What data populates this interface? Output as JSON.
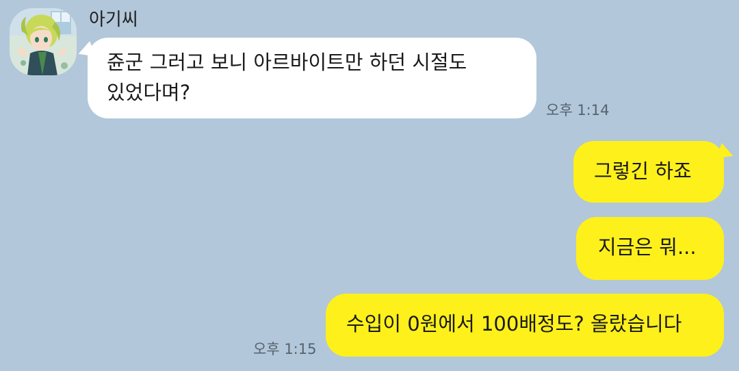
{
  "chat": {
    "sender_name": "아기씨",
    "avatar_icon": "profile-avatar",
    "messages": [
      {
        "direction": "incoming",
        "lines": [
          "쥰군 그러고 보니 아르바이트만 하던 시절도",
          "있었다며?"
        ],
        "time": "오후 1:14"
      },
      {
        "direction": "outgoing",
        "lines": [
          "그렇긴 하죠"
        ],
        "time": ""
      },
      {
        "direction": "outgoing",
        "lines": [
          "지금은 뭐..."
        ],
        "time": ""
      },
      {
        "direction": "outgoing",
        "lines": [
          "수입이 0원에서 100배정도? 올랐습니다"
        ],
        "time": "오후 1:15"
      }
    ]
  },
  "colors": {
    "background": "#b2c7d9",
    "incoming_bubble": "#ffffff",
    "outgoing_bubble": "#fef01b",
    "timestamp": "#55626e"
  }
}
